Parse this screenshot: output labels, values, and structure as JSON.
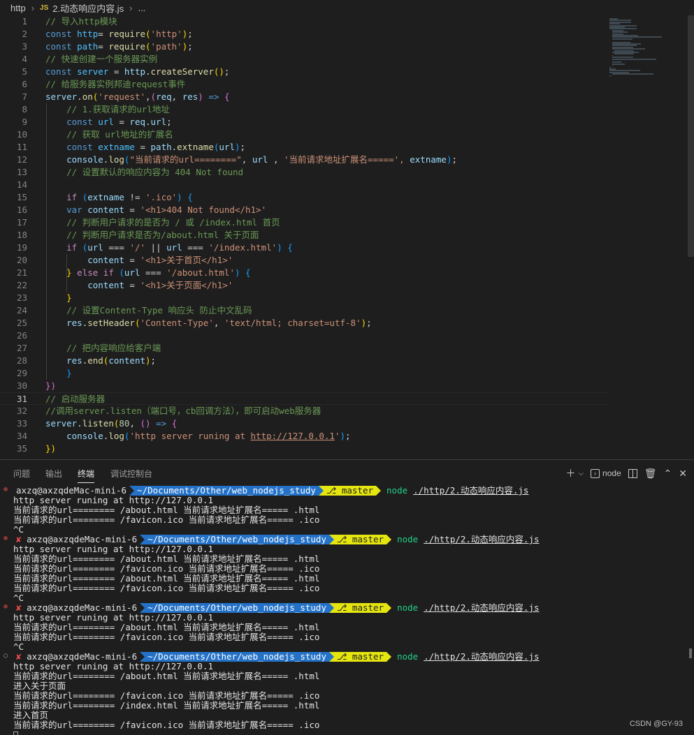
{
  "breadcrumb": {
    "folder": "http",
    "file_badge": "JS",
    "file": "2.动态响应内容.js",
    "more": "..."
  },
  "editor": {
    "active_line": 31,
    "lines": [
      [
        [
          "c",
          "// 导入http模块"
        ]
      ],
      [
        [
          "k",
          "const "
        ],
        [
          "cn",
          "http"
        ],
        [
          "",
          "="
        ],
        [
          "fn",
          " require"
        ],
        [
          "p1",
          "("
        ],
        [
          "s",
          "'http'"
        ],
        [
          "p1",
          ")"
        ],
        [
          "",
          ";"
        ]
      ],
      [
        [
          "k",
          "const "
        ],
        [
          "cn",
          "path"
        ],
        [
          "",
          "="
        ],
        [
          "fn",
          " require"
        ],
        [
          "p1",
          "("
        ],
        [
          "s",
          "'path'"
        ],
        [
          "p1",
          ")"
        ],
        [
          "",
          ";"
        ]
      ],
      [
        [
          "c",
          "// 快速创建一个服务器实例"
        ]
      ],
      [
        [
          "k",
          "const "
        ],
        [
          "cn",
          "server"
        ],
        [
          "",
          " = "
        ],
        [
          "v",
          "http"
        ],
        [
          "",
          "."
        ],
        [
          "fn",
          "createServer"
        ],
        [
          "p1",
          "()"
        ],
        [
          "",
          ";"
        ]
      ],
      [
        [
          "c",
          "// 给服务器实例邦迪request事件"
        ]
      ],
      [
        [
          "v",
          "server"
        ],
        [
          "",
          "."
        ],
        [
          "fn",
          "on"
        ],
        [
          "p1",
          "("
        ],
        [
          "s",
          "'request'"
        ],
        [
          "",
          ","
        ],
        [
          "p2",
          "("
        ],
        [
          "v",
          "req"
        ],
        [
          "",
          ", "
        ],
        [
          "v",
          "res"
        ],
        [
          "p2",
          ")"
        ],
        [
          "",
          " "
        ],
        [
          "k",
          "=>"
        ],
        [
          "",
          " "
        ],
        [
          "p2",
          "{"
        ]
      ],
      [
        [
          "",
          "    "
        ],
        [
          "c",
          "// 1.获取请求的url地址"
        ]
      ],
      [
        [
          "",
          "    "
        ],
        [
          "k",
          "const "
        ],
        [
          "cn",
          "url"
        ],
        [
          "",
          " = "
        ],
        [
          "v",
          "req"
        ],
        [
          "",
          "."
        ],
        [
          "v",
          "url"
        ],
        [
          "",
          ";"
        ]
      ],
      [
        [
          "",
          "    "
        ],
        [
          "c",
          "// 获取 url地址的扩展名"
        ]
      ],
      [
        [
          "",
          "    "
        ],
        [
          "k",
          "const "
        ],
        [
          "cn",
          "extname"
        ],
        [
          "",
          " = "
        ],
        [
          "v",
          "path"
        ],
        [
          "",
          "."
        ],
        [
          "fn",
          "extname"
        ],
        [
          "p3",
          "("
        ],
        [
          "v",
          "url"
        ],
        [
          "p3",
          ")"
        ],
        [
          "",
          ";"
        ]
      ],
      [
        [
          "",
          "    "
        ],
        [
          "v",
          "console"
        ],
        [
          "",
          "."
        ],
        [
          "fn",
          "log"
        ],
        [
          "p3",
          "("
        ],
        [
          "s",
          "\"当前请求的url========\""
        ],
        [
          "",
          ", "
        ],
        [
          "v",
          "url"
        ],
        [
          "",
          " , "
        ],
        [
          "s",
          "'当前请求地址扩展名=====',"
        ],
        [
          "",
          " "
        ],
        [
          "v",
          "extname"
        ],
        [
          "p3",
          ")"
        ],
        [
          "",
          ";"
        ]
      ],
      [
        [
          "",
          "    "
        ],
        [
          "c",
          "// 设置默认的响应内容为 404 Not found"
        ]
      ],
      [
        [
          "",
          ""
        ]
      ],
      [
        [
          "",
          "    "
        ],
        [
          "ctl",
          "if "
        ],
        [
          "p3",
          "("
        ],
        [
          "v",
          "extname"
        ],
        [
          "",
          " != "
        ],
        [
          "s",
          "'.ico'"
        ],
        [
          "p3",
          ")"
        ],
        [
          "",
          " "
        ],
        [
          "p3",
          "{"
        ]
      ],
      [
        [
          "",
          "    "
        ],
        [
          "k",
          "var "
        ],
        [
          "v",
          "content"
        ],
        [
          "",
          " = "
        ],
        [
          "s",
          "'<h1>404 Not found</h1>'"
        ]
      ],
      [
        [
          "",
          "    "
        ],
        [
          "c",
          "// 判断用户请求的是否为 / 或 /index.html 首页"
        ]
      ],
      [
        [
          "",
          "    "
        ],
        [
          "c",
          "// 判断用户请求是否为/about.html 关于页面"
        ]
      ],
      [
        [
          "",
          "    "
        ],
        [
          "ctl",
          "if "
        ],
        [
          "p3",
          "("
        ],
        [
          "v",
          "url"
        ],
        [
          "",
          " === "
        ],
        [
          "s",
          "'/'"
        ],
        [
          "",
          " || "
        ],
        [
          "v",
          "url"
        ],
        [
          "",
          " === "
        ],
        [
          "s",
          "'/index.html'"
        ],
        [
          "p3",
          ")"
        ],
        [
          "",
          " "
        ],
        [
          "p3",
          "{"
        ]
      ],
      [
        [
          "",
          "        "
        ],
        [
          "v",
          "content"
        ],
        [
          "",
          " = "
        ],
        [
          "s",
          "'<h1>关于首页</h1>'"
        ]
      ],
      [
        [
          "",
          "    "
        ],
        [
          "p1",
          "}"
        ],
        [
          "",
          " "
        ],
        [
          "ctl",
          "else if "
        ],
        [
          "p3",
          "("
        ],
        [
          "v",
          "url"
        ],
        [
          "",
          " === "
        ],
        [
          "s",
          "'/about.html'"
        ],
        [
          "p3",
          ")"
        ],
        [
          "",
          " "
        ],
        [
          "p3",
          "{"
        ]
      ],
      [
        [
          "",
          "        "
        ],
        [
          "v",
          "content"
        ],
        [
          "",
          " = "
        ],
        [
          "s",
          "'<h1>关于页面</h1>'"
        ]
      ],
      [
        [
          "",
          "    "
        ],
        [
          "p1",
          "}"
        ]
      ],
      [
        [
          "",
          "    "
        ],
        [
          "c",
          "// 设置Content-Type 响应头 防止中文乱码"
        ]
      ],
      [
        [
          "",
          "    "
        ],
        [
          "v",
          "res"
        ],
        [
          "",
          "."
        ],
        [
          "fn",
          "setHeader"
        ],
        [
          "p1",
          "("
        ],
        [
          "s",
          "'Content-Type'"
        ],
        [
          "",
          ", "
        ],
        [
          "s",
          "'text/html; charset=utf-8'"
        ],
        [
          "p1",
          ")"
        ],
        [
          "",
          ";"
        ]
      ],
      [
        [
          "",
          ""
        ]
      ],
      [
        [
          "",
          "    "
        ],
        [
          "c",
          "// 把内容响应给客户端"
        ]
      ],
      [
        [
          "",
          "    "
        ],
        [
          "v",
          "res"
        ],
        [
          "",
          "."
        ],
        [
          "fn",
          "end"
        ],
        [
          "p1",
          "("
        ],
        [
          "v",
          "content"
        ],
        [
          "p1",
          ")"
        ],
        [
          "",
          ";"
        ]
      ],
      [
        [
          "",
          "    "
        ],
        [
          "p3",
          "}"
        ]
      ],
      [
        [
          "p2",
          "})"
        ]
      ],
      [
        [
          "c",
          "// 启动服务器"
        ]
      ],
      [
        [
          "c",
          "//调用server.listen（端口号，cb回调方法），即可启动web服务器"
        ]
      ],
      [
        [
          "v",
          "server"
        ],
        [
          "",
          "."
        ],
        [
          "fn",
          "listen"
        ],
        [
          "p1",
          "("
        ],
        [
          "n",
          "80"
        ],
        [
          "",
          ", "
        ],
        [
          "p2",
          "()"
        ],
        [
          "",
          " "
        ],
        [
          "k",
          "=>"
        ],
        [
          "",
          " "
        ],
        [
          "p2",
          "{"
        ]
      ],
      [
        [
          "",
          "    "
        ],
        [
          "v",
          "console"
        ],
        [
          "",
          "."
        ],
        [
          "fn",
          "log"
        ],
        [
          "p3",
          "("
        ],
        [
          "s",
          "'http server runing at "
        ],
        [
          "sul",
          "http://127.0.0.1"
        ],
        [
          "s",
          "'"
        ],
        [
          "p3",
          ")"
        ],
        [
          "",
          ";"
        ]
      ],
      [
        [
          "p1",
          "})"
        ]
      ]
    ]
  },
  "panel": {
    "tabs": [
      "问题",
      "输出",
      "终端",
      "调试控制台"
    ],
    "active_tab": "终端",
    "terminal_name": "node"
  },
  "terminal": {
    "prompt": {
      "user": "axzq@axzqdeMac-mini-6",
      "dir": "~/Documents/Other/web_nodejs_study",
      "branch": "master",
      "cmd": "node",
      "arg": "./http/2.动态响应内容.js"
    },
    "blocks": [
      {
        "status": "error",
        "cross": false,
        "output": [
          "http server runing at http://127.0.0.1",
          "当前请求的url======== /about.html 当前请求地址扩展名===== .html",
          "当前请求的url======== /favicon.ico 当前请求地址扩展名===== .ico",
          "^C"
        ]
      },
      {
        "status": "error",
        "cross": true,
        "output": [
          "http server runing at http://127.0.0.1",
          "当前请求的url======== /about.html 当前请求地址扩展名===== .html",
          "当前请求的url======== /favicon.ico 当前请求地址扩展名===== .ico",
          "当前请求的url======== /about.html 当前请求地址扩展名===== .html",
          "当前请求的url======== /favicon.ico 当前请求地址扩展名===== .ico",
          "^C"
        ]
      },
      {
        "status": "error",
        "cross": true,
        "output": [
          "http server runing at http://127.0.0.1",
          "当前请求的url======== /about.html 当前请求地址扩展名===== .html",
          "当前请求的url======== /favicon.ico 当前请求地址扩展名===== .ico",
          "^C"
        ]
      },
      {
        "status": "running",
        "cross": true,
        "output": [
          "http server runing at http://127.0.0.1",
          "当前请求的url======== /about.html 当前请求地址扩展名===== .html",
          "进入关于页面",
          "当前请求的url======== /favicon.ico 当前请求地址扩展名===== .ico",
          "当前请求的url======== /index.html 当前请求地址扩展名===== .html",
          "进入首页",
          "当前请求的url======== /favicon.ico 当前请求地址扩展名===== .ico"
        ]
      }
    ]
  },
  "watermark": "CSDN @GY-93",
  "colors": {
    "dir_segment": "#2472c8",
    "git_segment": "#e5e510",
    "error_dot": "#f14c4c",
    "command": "#23d18b"
  }
}
